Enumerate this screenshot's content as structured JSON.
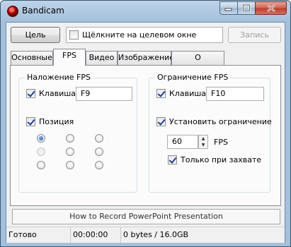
{
  "window": {
    "title": "Bandicam"
  },
  "toolbar": {
    "target_label": "Цель",
    "click_target_label": "Щёлкните на целевом окне",
    "save_label": "Запись"
  },
  "tabs": [
    {
      "label": "Основные"
    },
    {
      "label": "FPS"
    },
    {
      "label": "Видео"
    },
    {
      "label": "Изображение"
    },
    {
      "label": "О программе"
    }
  ],
  "fps_overlay": {
    "title": "Наложение FPS",
    "hotkey_label": "Клавиша",
    "hotkey_value": "F9",
    "position_label": "Позиция"
  },
  "fps_limit": {
    "title": "Ограничение FPS",
    "hotkey_label": "Клавиша",
    "hotkey_value": "F10",
    "set_limit_label": "Установить ограничение",
    "fps_value": "60",
    "fps_unit": "FPS",
    "only_capture_label": "Только при захвате"
  },
  "promo": {
    "text": "How to Record PowerPoint Presentation"
  },
  "status": {
    "state": "Готово",
    "time": "00:00:00",
    "size": "0 bytes / 16.0GB"
  }
}
